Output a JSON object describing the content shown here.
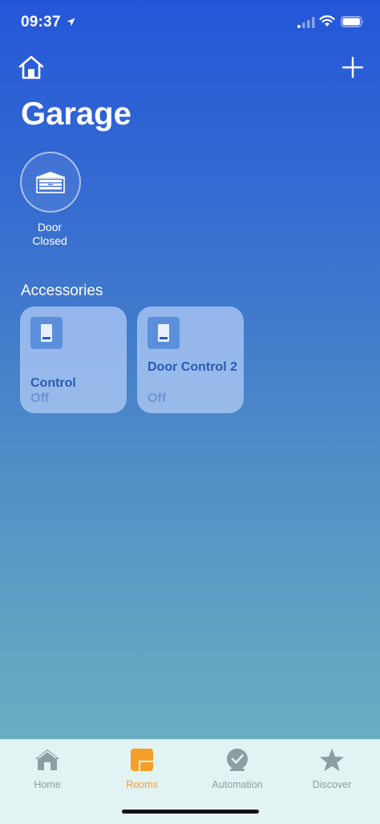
{
  "status_bar": {
    "time": "09:37"
  },
  "header": {
    "title": "Garage"
  },
  "garage_status": {
    "line1": "Door",
    "line2": "Closed"
  },
  "accessories": {
    "section_title": "Accessories",
    "tiles": [
      {
        "name": "Control",
        "state": "Off"
      },
      {
        "name": "Door Control 2",
        "state": "Off"
      }
    ]
  },
  "tabs": [
    {
      "label": "Home",
      "icon": "house-icon"
    },
    {
      "label": "Rooms",
      "icon": "rooms-icon",
      "active": true
    },
    {
      "label": "Automation",
      "icon": "clock-check-icon"
    },
    {
      "label": "Discover",
      "icon": "star-icon"
    }
  ],
  "colors": {
    "active_tab": "#f39f2a",
    "tile_text": "#2a5bb0"
  }
}
